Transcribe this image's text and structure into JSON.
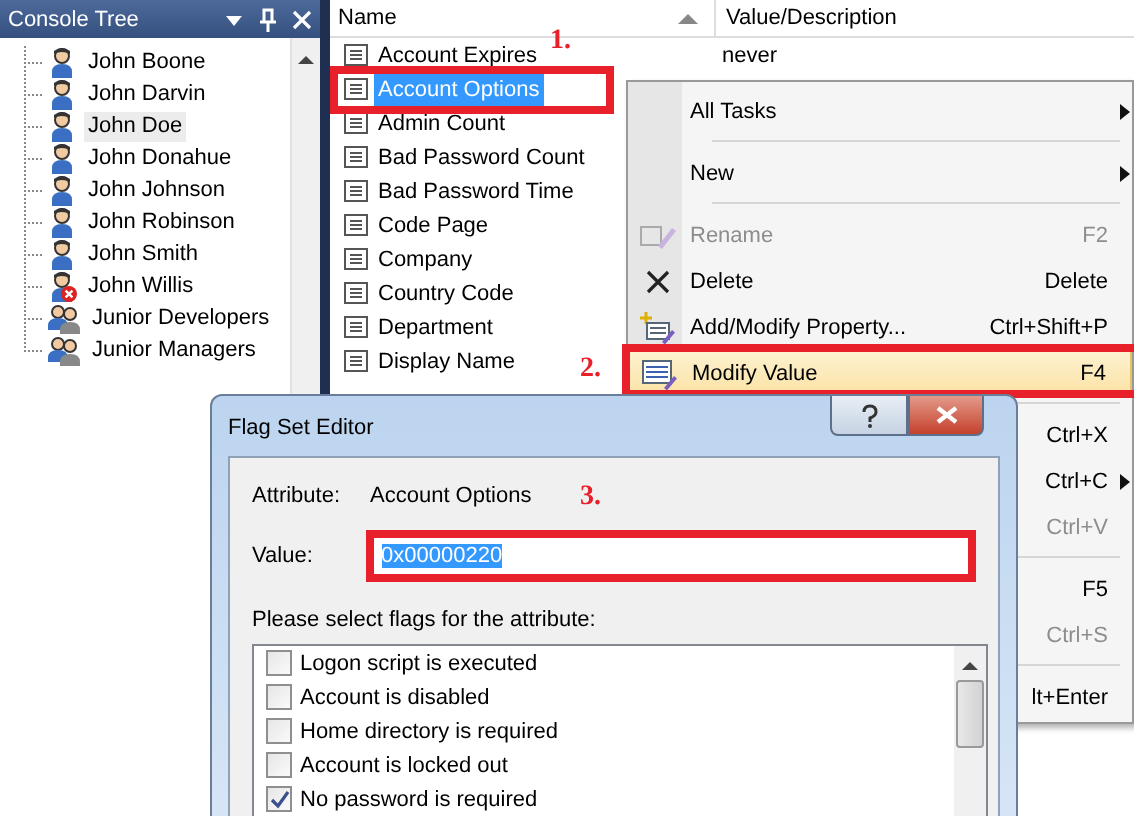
{
  "console_tree": {
    "title": "Console Tree",
    "items": [
      {
        "label": "John Boone",
        "kind": "user",
        "selected": false
      },
      {
        "label": "John Darvin",
        "kind": "user",
        "selected": false
      },
      {
        "label": "John Doe",
        "kind": "user",
        "selected": true
      },
      {
        "label": "John Donahue",
        "kind": "user",
        "selected": false
      },
      {
        "label": "John Johnson",
        "kind": "user",
        "selected": false
      },
      {
        "label": "John Robinson",
        "kind": "user",
        "selected": false
      },
      {
        "label": "John Smith",
        "kind": "user",
        "selected": false
      },
      {
        "label": "John Willis",
        "kind": "disabled-user",
        "selected": false
      },
      {
        "label": "Junior Developers",
        "kind": "group",
        "selected": false
      },
      {
        "label": "Junior Managers",
        "kind": "group",
        "selected": false
      }
    ]
  },
  "attributes": {
    "columns": [
      "Name",
      "Value/Description"
    ],
    "rows": [
      {
        "name": "Account Expires",
        "value": "never",
        "selected": false
      },
      {
        "name": "Account Options",
        "selected": true
      },
      {
        "name": "Admin Count",
        "selected": false
      },
      {
        "name": "Bad Password Count",
        "selected": false
      },
      {
        "name": "Bad Password Time",
        "selected": false
      },
      {
        "name": "Code Page",
        "selected": false
      },
      {
        "name": "Company",
        "selected": false
      },
      {
        "name": "Country Code",
        "selected": false
      },
      {
        "name": "Department",
        "selected": false
      },
      {
        "name": "Display Name",
        "selected": false
      }
    ]
  },
  "context_menu": {
    "items": [
      {
        "kind": "item",
        "label": "All Tasks",
        "submenu": true,
        "disabled": false,
        "selected": false
      },
      {
        "kind": "separator"
      },
      {
        "kind": "item",
        "label": "New",
        "submenu": true,
        "disabled": false,
        "selected": false
      },
      {
        "kind": "separator"
      },
      {
        "kind": "rename",
        "label": "Rename",
        "shortcut": "F2",
        "disabled": true,
        "selected": false
      },
      {
        "kind": "delete",
        "label": "Delete",
        "shortcut": "Delete",
        "disabled": false,
        "selected": false
      },
      {
        "kind": "add-property",
        "label": "Add/Modify Property...",
        "shortcut": "Ctrl+Shift+P",
        "disabled": false,
        "selected": false
      },
      {
        "kind": "modify",
        "label": "Modify Value",
        "shortcut": "F4",
        "disabled": false,
        "selected": true
      },
      {
        "kind": "separator"
      },
      {
        "kind": "item",
        "shortcut": "Ctrl+X",
        "disabled": false,
        "selected": false
      },
      {
        "kind": "item",
        "shortcut": "Ctrl+C",
        "submenu": true,
        "disabled": false,
        "selected": false
      },
      {
        "kind": "item",
        "shortcut": "Ctrl+V",
        "disabled": true,
        "selected": false
      },
      {
        "kind": "separator"
      },
      {
        "kind": "item",
        "shortcut": "F5",
        "disabled": false,
        "selected": false
      },
      {
        "kind": "item",
        "shortcut": "Ctrl+S",
        "disabled": true,
        "selected": false
      },
      {
        "kind": "separator"
      },
      {
        "kind": "item",
        "shortcut": "lt+Enter",
        "disabled": false,
        "selected": false
      }
    ]
  },
  "annotations": [
    "1.",
    "2.",
    "3."
  ],
  "dialog": {
    "title": "Flag Set Editor",
    "attribute_label": "Attribute:",
    "attribute_value": "Account Options",
    "value_label": "Value:",
    "value": "0x00000220",
    "prompt": "Please select flags for the attribute:",
    "flags": [
      {
        "label": "Logon script is executed",
        "checked": false
      },
      {
        "label": "Account is disabled",
        "checked": false
      },
      {
        "label": "Home directory is required",
        "checked": false
      },
      {
        "label": "Account is locked out",
        "checked": false
      },
      {
        "label": "No password is required",
        "checked": true
      }
    ]
  }
}
